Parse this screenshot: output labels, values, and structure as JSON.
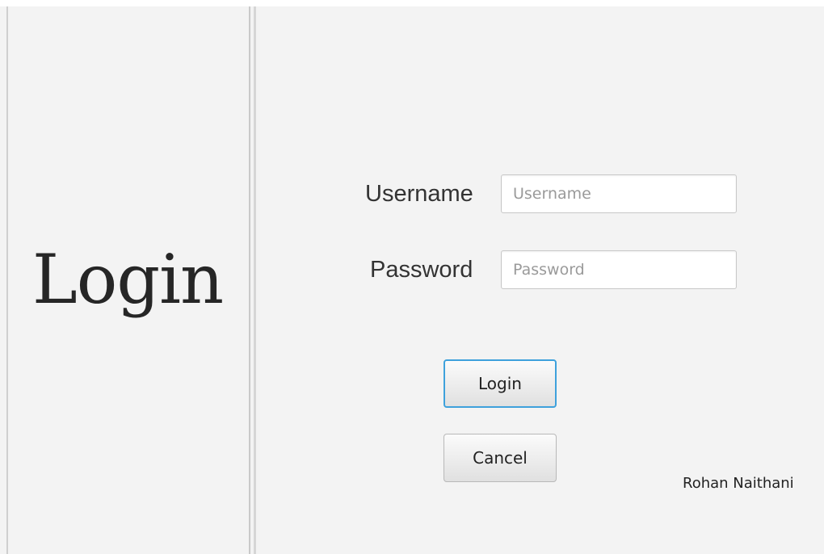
{
  "side_panel": {
    "title": "Login"
  },
  "form": {
    "username_label": "Username",
    "username_placeholder": "Username",
    "password_label": "Password",
    "password_placeholder": "Password",
    "login_button": "Login",
    "cancel_button": "Cancel"
  },
  "footer": {
    "author": "Rohan Naithani"
  },
  "colors": {
    "background": "#f3f3f3",
    "focus_accent": "#3ea1dc",
    "text": "#262626"
  }
}
